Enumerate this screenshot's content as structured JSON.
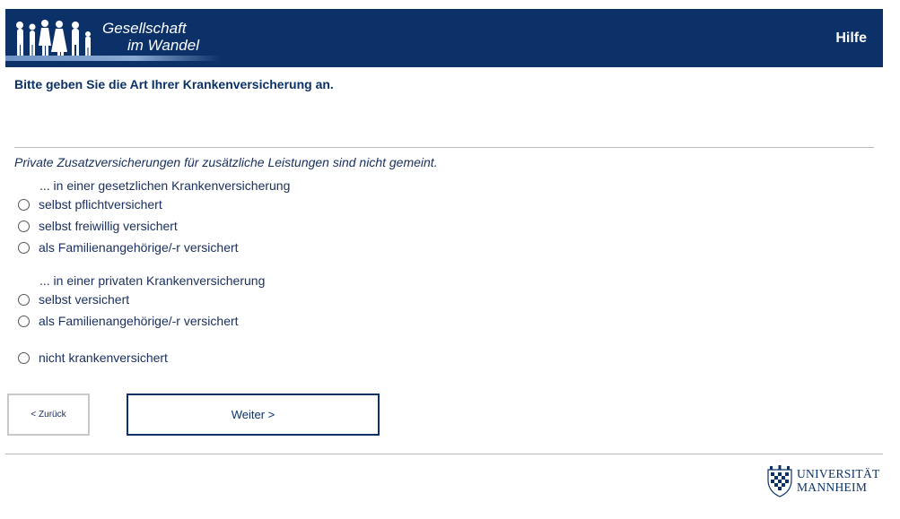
{
  "header": {
    "logo_line1": "Gesellschaft",
    "logo_line2": "im Wandel",
    "help_label": "Hilfe"
  },
  "question": {
    "title": "Bitte geben Sie die Art Ihrer Krankenversicherung an.",
    "hint": "Private Zusatzversicherungen für zusätzliche Leistungen sind nicht gemeint."
  },
  "groups": {
    "public_label": "... in einer gesetzlichen Krankenversicherung",
    "private_label": "... in einer privaten Krankenversicherung"
  },
  "options": [
    "selbst pflichtversichert",
    "selbst freiwillig versichert",
    "als Familienangehörige/-r versichert",
    "selbst versichert",
    "als Familienangehörige/-r versichert",
    "nicht krankenversichert"
  ],
  "nav": {
    "back_label": "< Zurück",
    "next_label": "Weiter >"
  },
  "footer": {
    "university_line1": "UNIVERSITÄT",
    "university_line2": "MANNHEIM"
  },
  "colors": {
    "brand_navy": "#0b3168",
    "text": "#1a3060"
  }
}
